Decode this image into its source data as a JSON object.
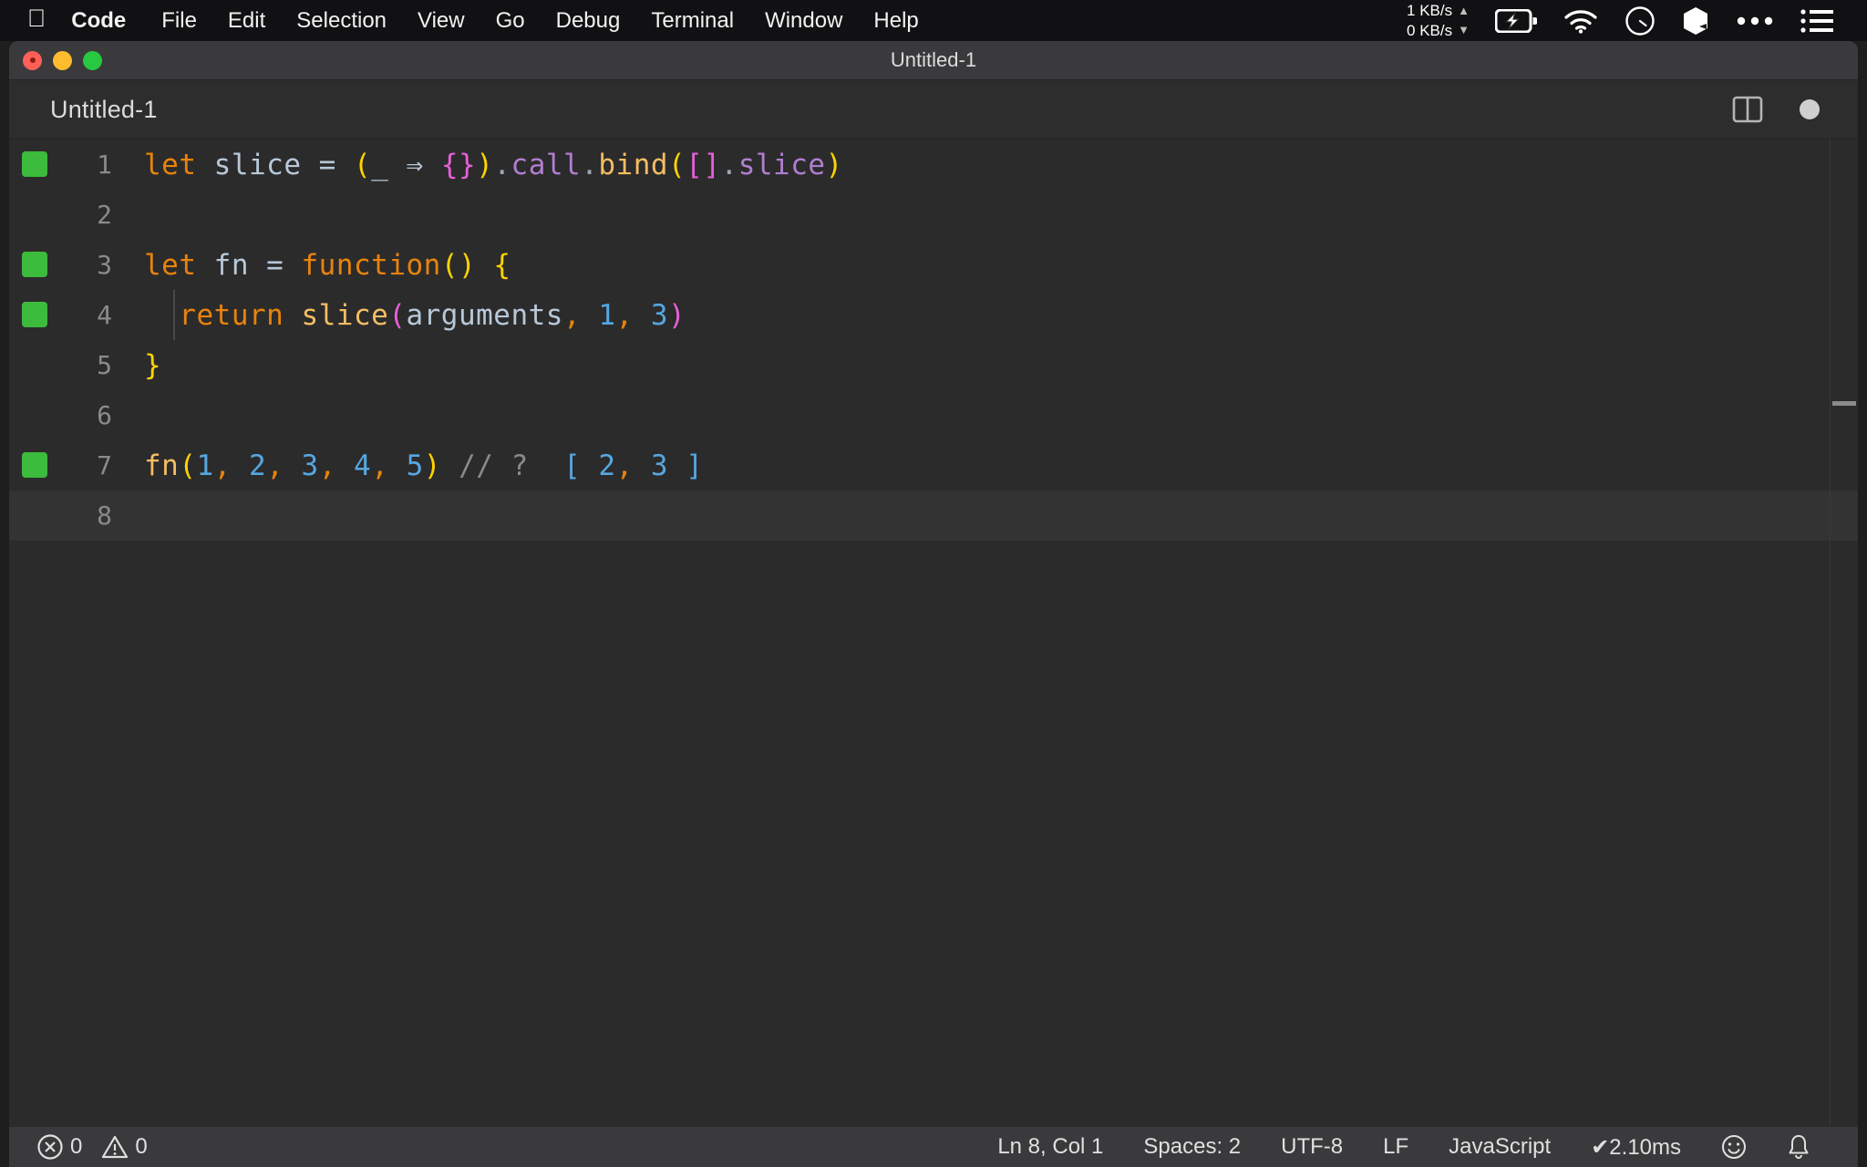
{
  "menubar": {
    "apple_icon": "apple-logo-icon",
    "items": [
      {
        "label": "Code",
        "bold": true
      },
      {
        "label": "File",
        "bold": false
      },
      {
        "label": "Edit",
        "bold": false
      },
      {
        "label": "Selection",
        "bold": false
      },
      {
        "label": "View",
        "bold": false
      },
      {
        "label": "Go",
        "bold": false
      },
      {
        "label": "Debug",
        "bold": false
      },
      {
        "label": "Terminal",
        "bold": false
      },
      {
        "label": "Window",
        "bold": false
      },
      {
        "label": "Help",
        "bold": false
      }
    ],
    "tray": {
      "net_up": "1 KB/s",
      "net_down": "0 KB/s",
      "up_arrow": "▲",
      "down_arrow": "▼",
      "battery_icon": "battery-charging-icon",
      "wifi_icon": "wifi-icon",
      "clock_icon": "clock-icon",
      "dropbox_icon": "dropbox-icon",
      "more_icon": "ellipsis-icon",
      "controlcenter_icon": "list-menu-icon"
    }
  },
  "window": {
    "title": "Untitled-1",
    "traffic_lights": [
      "close-button",
      "minimize-button",
      "zoom-button"
    ]
  },
  "tabbar": {
    "tab_label": "Untitled-1",
    "split_editor_icon": "split-editor-icon",
    "dirty_indicator": "unsaved-dot-icon"
  },
  "editor": {
    "language": "JavaScript",
    "indent_guide_lines": [
      4
    ],
    "lines": [
      {
        "number": "1",
        "git_change": true,
        "tokens": [
          {
            "text": "let",
            "cls": "t-kw"
          },
          {
            "text": " ",
            "cls": "t-var"
          },
          {
            "text": "slice",
            "cls": "t-var"
          },
          {
            "text": " ",
            "cls": "t-var"
          },
          {
            "text": "=",
            "cls": "t-op"
          },
          {
            "text": " ",
            "cls": "t-var"
          },
          {
            "text": "(",
            "cls": "t-paren"
          },
          {
            "text": "_",
            "cls": "t-var"
          },
          {
            "text": " ",
            "cls": "t-var"
          },
          {
            "text": "⇒",
            "cls": "t-arrow"
          },
          {
            "text": " ",
            "cls": "t-var"
          },
          {
            "text": "{}",
            "cls": "t-brace-m"
          },
          {
            "text": ")",
            "cls": "t-paren"
          },
          {
            "text": ".",
            "cls": "t-dot"
          },
          {
            "text": "call",
            "cls": "t-prop"
          },
          {
            "text": ".",
            "cls": "t-dot"
          },
          {
            "text": "bind",
            "cls": "t-fn"
          },
          {
            "text": "(",
            "cls": "t-paren"
          },
          {
            "text": "[]",
            "cls": "t-brace-m"
          },
          {
            "text": ".",
            "cls": "t-dot"
          },
          {
            "text": "slice",
            "cls": "t-prop"
          },
          {
            "text": ")",
            "cls": "t-paren"
          }
        ]
      },
      {
        "number": "2",
        "git_change": false,
        "tokens": []
      },
      {
        "number": "3",
        "git_change": true,
        "tokens": [
          {
            "text": "let",
            "cls": "t-kw"
          },
          {
            "text": " ",
            "cls": "t-var"
          },
          {
            "text": "fn",
            "cls": "t-var"
          },
          {
            "text": " ",
            "cls": "t-var"
          },
          {
            "text": "=",
            "cls": "t-op"
          },
          {
            "text": " ",
            "cls": "t-var"
          },
          {
            "text": "function",
            "cls": "t-kw"
          },
          {
            "text": "()",
            "cls": "t-paren"
          },
          {
            "text": " ",
            "cls": "t-var"
          },
          {
            "text": "{",
            "cls": "t-paren"
          }
        ]
      },
      {
        "number": "4",
        "git_change": true,
        "tokens": [
          {
            "text": "  ",
            "cls": "t-var"
          },
          {
            "text": "return",
            "cls": "t-kw"
          },
          {
            "text": " ",
            "cls": "t-var"
          },
          {
            "text": "slice",
            "cls": "t-fn"
          },
          {
            "text": "(",
            "cls": "t-brace-m"
          },
          {
            "text": "arguments",
            "cls": "t-var"
          },
          {
            "text": ",",
            "cls": "t-comma"
          },
          {
            "text": " ",
            "cls": "t-var"
          },
          {
            "text": "1",
            "cls": "t-num"
          },
          {
            "text": ",",
            "cls": "t-comma"
          },
          {
            "text": " ",
            "cls": "t-var"
          },
          {
            "text": "3",
            "cls": "t-num"
          },
          {
            "text": ")",
            "cls": "t-brace-m"
          }
        ]
      },
      {
        "number": "5",
        "git_change": false,
        "tokens": [
          {
            "text": "}",
            "cls": "t-paren"
          }
        ]
      },
      {
        "number": "6",
        "git_change": false,
        "tokens": []
      },
      {
        "number": "7",
        "git_change": true,
        "tokens": [
          {
            "text": "fn",
            "cls": "t-fn"
          },
          {
            "text": "(",
            "cls": "t-paren"
          },
          {
            "text": "1",
            "cls": "t-num"
          },
          {
            "text": ",",
            "cls": "t-comma"
          },
          {
            "text": " ",
            "cls": "t-var"
          },
          {
            "text": "2",
            "cls": "t-num"
          },
          {
            "text": ",",
            "cls": "t-comma"
          },
          {
            "text": " ",
            "cls": "t-var"
          },
          {
            "text": "3",
            "cls": "t-num"
          },
          {
            "text": ",",
            "cls": "t-comma"
          },
          {
            "text": " ",
            "cls": "t-var"
          },
          {
            "text": "4",
            "cls": "t-num"
          },
          {
            "text": ",",
            "cls": "t-comma"
          },
          {
            "text": " ",
            "cls": "t-var"
          },
          {
            "text": "5",
            "cls": "t-num"
          },
          {
            "text": ")",
            "cls": "t-paren"
          },
          {
            "text": " ",
            "cls": "t-var"
          },
          {
            "text": "// ?",
            "cls": "t-comment"
          },
          {
            "text": "  ",
            "cls": "t-var"
          },
          {
            "text": "[",
            "cls": "t-num"
          },
          {
            "text": " ",
            "cls": "t-var"
          },
          {
            "text": "2",
            "cls": "t-num"
          },
          {
            "text": ",",
            "cls": "t-comma"
          },
          {
            "text": " ",
            "cls": "t-var"
          },
          {
            "text": "3",
            "cls": "t-num"
          },
          {
            "text": " ",
            "cls": "t-var"
          },
          {
            "text": "]",
            "cls": "t-num"
          }
        ]
      },
      {
        "number": "8",
        "git_change": false,
        "current": true,
        "tokens": []
      }
    ]
  },
  "statusbar": {
    "errors_icon": "error-circle-icon",
    "errors_count": "0",
    "warnings_icon": "warning-triangle-icon",
    "warnings_count": "0",
    "cursor_position": "Ln 8, Col 1",
    "indentation": "Spaces: 2",
    "encoding": "UTF-8",
    "eol": "LF",
    "language_mode": "JavaScript",
    "check_icon": "checkmark-icon",
    "timing": "2.10ms",
    "feedback_icon": "smiley-icon",
    "notifications_icon": "bell-icon"
  },
  "colors": {
    "menubar_bg": "#111113",
    "titlebar_bg": "#3a3a3c",
    "tabbar_bg": "#2d2d2d",
    "editor_bg": "#2b2b2b",
    "statusbar_bg": "#3a3a3c",
    "git_added": "#3cbb3c"
  }
}
